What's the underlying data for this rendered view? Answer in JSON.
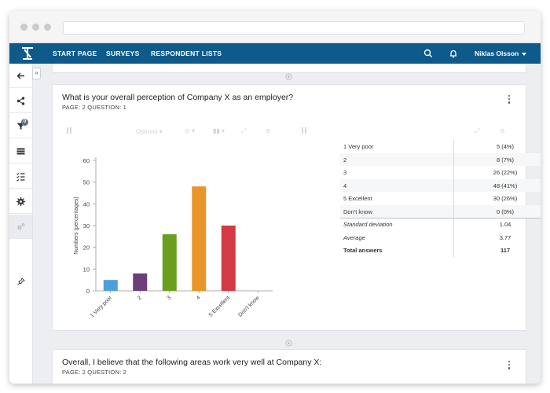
{
  "nav": {
    "links": [
      "START PAGE",
      "SURVEYS",
      "RESPONDENT LISTS"
    ],
    "user": "Niklas Olsson"
  },
  "sidebar": {
    "icons": [
      "back-arrow-icon",
      "share-icon",
      "filter-icon",
      "list-icon",
      "checklist-icon",
      "gear-icon",
      "gears-icon",
      "pin-icon"
    ],
    "filter_count": "0"
  },
  "question1": {
    "title": "What is your overall perception of Company X as an employer?",
    "subtitle": "PAGE: 2 QUESTION: 1",
    "options_label": "Options"
  },
  "chart_data": {
    "type": "bar",
    "ylabel": "Numbers (percentages)",
    "categories": [
      "1 Very poor",
      "2",
      "3",
      "4",
      "5 Excellent",
      "Don't know"
    ],
    "values": [
      5,
      8,
      26,
      48,
      30,
      0
    ],
    "colors": [
      "#4ea0da",
      "#6b3f7a",
      "#6a9e1f",
      "#e8962a",
      "#d23a45",
      "#999999"
    ],
    "ylim": [
      0,
      60
    ],
    "yticks": [
      "0",
      "10",
      "20",
      "30",
      "40",
      "50",
      "60"
    ],
    "grid": false
  },
  "table": {
    "rows": [
      {
        "label": "1 Very poor",
        "value": "5 (4%)"
      },
      {
        "label": "2",
        "value": "8 (7%)"
      },
      {
        "label": "3",
        "value": "26 (22%)"
      },
      {
        "label": "4",
        "value": "48 (41%)"
      },
      {
        "label": "5 Excellent",
        "value": "30 (26%)"
      },
      {
        "label": "Don't know",
        "value": "0 (0%)"
      }
    ],
    "stats": [
      {
        "label": "Standard deviation",
        "value": "1.04"
      },
      {
        "label": "Average",
        "value": "3.77"
      }
    ],
    "total": {
      "label": "Total answers",
      "value": "117"
    }
  },
  "question2": {
    "title": "Overall, I believe that the following areas work very well at Company X:",
    "subtitle": "PAGE: 2 QUESTION: 2"
  }
}
